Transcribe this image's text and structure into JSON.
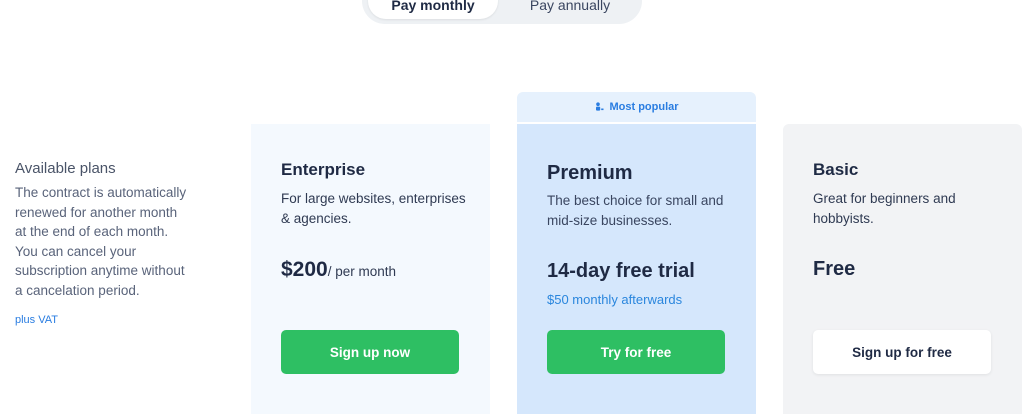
{
  "billing_toggle": {
    "monthly_label": "Pay monthly",
    "annually_label": "Pay annually",
    "selected": "monthly"
  },
  "info": {
    "title": "Available plans",
    "description": "The contract is automatically renewed for another month at the end of each month. You can cancel your subscription anytime without a cancelation period.",
    "vat_note": "plus VAT"
  },
  "plans": [
    {
      "name": "Enterprise",
      "tagline": "For large websites, enterprises & agencies.",
      "price": "$200",
      "price_unit": "/ per month",
      "button_label": "Sign up now"
    },
    {
      "name": "Premium",
      "badge": "Most popular",
      "tagline": "The best choice for small and mid-size businesses.",
      "price": "14-day free trial",
      "price_note": "$50 monthly afterwards",
      "button_label": "Try for free"
    },
    {
      "name": "Basic",
      "tagline": "Great for beginners and hobbyists.",
      "price": "Free",
      "button_label": "Sign up for free"
    }
  ],
  "colors": {
    "accent_green": "#2ebf63",
    "accent_blue": "#2a7de1",
    "premium_bg": "#d5e7fc",
    "enterprise_bg": "#f4f9fe",
    "basic_bg": "#f2f3f5"
  },
  "icons": {
    "popular_badge_icon": "person-icon"
  }
}
